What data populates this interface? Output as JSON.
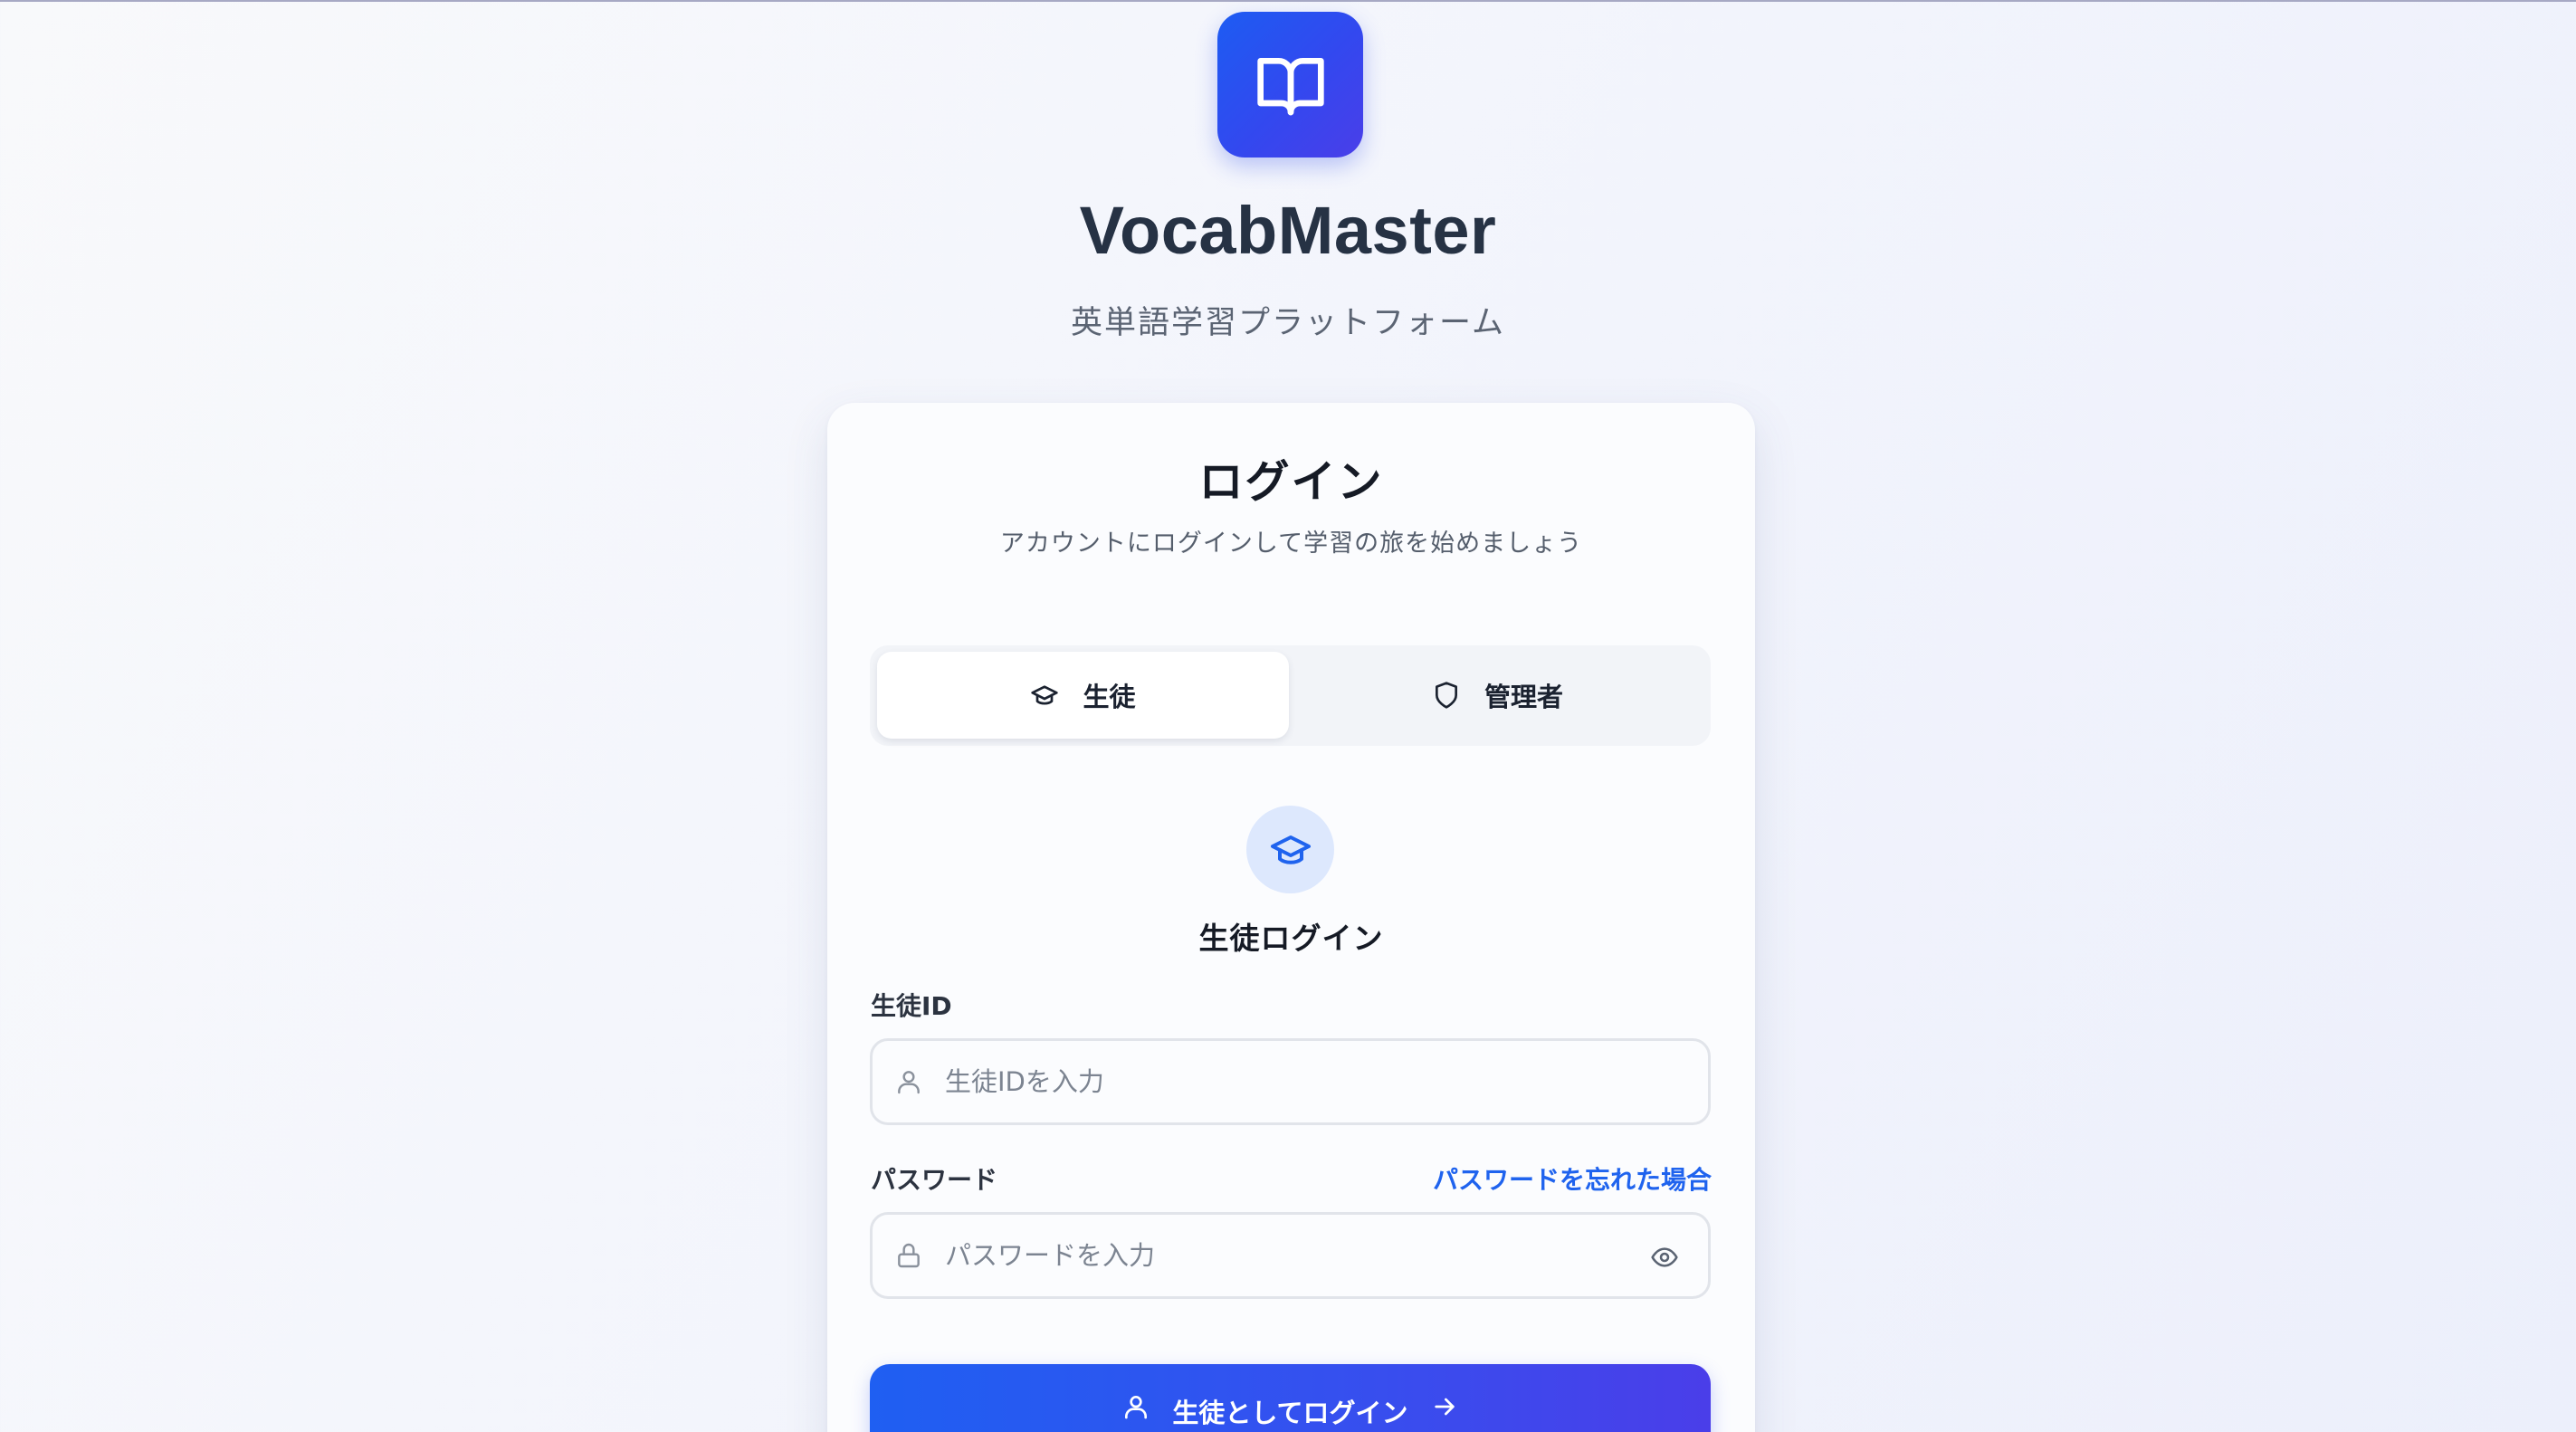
{
  "app": {
    "name": "VocabMaster",
    "tagline": "英単語学習プラットフォーム"
  },
  "login_card": {
    "title": "ログイン",
    "subtitle": "アカウントにログインして学習の旅を始めましょう",
    "tabs": [
      {
        "label": "生徒",
        "icon": "graduation-cap-icon",
        "active": true
      },
      {
        "label": "管理者",
        "icon": "shield-icon",
        "active": false
      }
    ],
    "role_icon": "graduation-cap-icon",
    "role_title": "生徒ログイン",
    "student_id": {
      "label": "生徒ID",
      "placeholder": "生徒IDを入力",
      "value": "",
      "icon": "user-icon"
    },
    "password": {
      "label": "パスワード",
      "placeholder": "パスワードを入力",
      "value": "",
      "icon": "lock-icon",
      "toggle_icon": "eye-icon"
    },
    "forgot_link": "パスワードを忘れた場合",
    "submit": {
      "label": "生徒としてログイン",
      "lead_icon": "user-icon",
      "trail_icon": "arrow-right-icon"
    }
  },
  "colors": {
    "accent": "#1f63ee",
    "gradient_start": "#1d5cf2",
    "gradient_end": "#4a3ee9",
    "role_icon_bg": "#dde8fd"
  }
}
